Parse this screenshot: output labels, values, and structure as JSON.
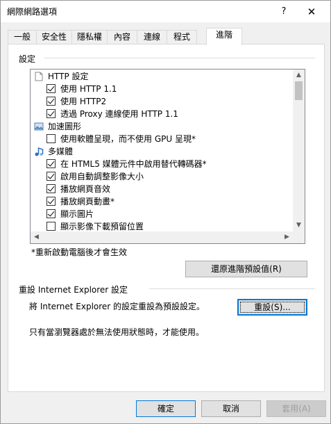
{
  "window": {
    "title": "網際網路選項",
    "help_label": "?",
    "close_label": "✕"
  },
  "tabs": [
    {
      "label": "一般"
    },
    {
      "label": "安全性"
    },
    {
      "label": "隱私權"
    },
    {
      "label": "內容"
    },
    {
      "label": "連線"
    },
    {
      "label": "程式"
    },
    {
      "label": "進階",
      "active": true
    }
  ],
  "settings": {
    "group_label": "設定",
    "tree": [
      {
        "type": "category",
        "icon": "page-icon",
        "label": "HTTP 設定"
      },
      {
        "type": "checkbox",
        "checked": true,
        "label": "使用 HTTP 1.1"
      },
      {
        "type": "checkbox",
        "checked": true,
        "label": "使用 HTTP2"
      },
      {
        "type": "checkbox",
        "checked": true,
        "label": "透過 Proxy 連線使用 HTTP 1.1"
      },
      {
        "type": "category",
        "icon": "image-icon",
        "label": "加速圖形"
      },
      {
        "type": "checkbox",
        "checked": false,
        "label": "使用軟體呈現，而不使用 GPU 呈現*"
      },
      {
        "type": "category",
        "icon": "multimedia-icon",
        "label": "多媒體"
      },
      {
        "type": "checkbox",
        "checked": true,
        "label": "在 HTML5 媒體元件中啟用替代轉碼器*"
      },
      {
        "type": "checkbox",
        "checked": true,
        "label": "啟用自動調整影像大小"
      },
      {
        "type": "checkbox",
        "checked": true,
        "label": "播放網頁音效"
      },
      {
        "type": "checkbox",
        "checked": true,
        "label": "播放網頁動畫*"
      },
      {
        "type": "checkbox",
        "checked": true,
        "label": "顯示圖片"
      },
      {
        "type": "checkbox",
        "checked": false,
        "label": "顯示影像下載預留位置"
      }
    ],
    "restart_note": "*重新啟動電腦後才會生效",
    "restore_button": "還原進階預設值(R)"
  },
  "reset": {
    "group_label": "重設 Internet Explorer 設定",
    "description": "將 Internet Explorer 的設定重設為預設設定。",
    "button": "重設(S)...",
    "note": "只有當瀏覽器處於無法使用狀態時，才能使用。"
  },
  "footer": {
    "ok": "確定",
    "cancel": "取消",
    "apply": "套用(A)"
  }
}
